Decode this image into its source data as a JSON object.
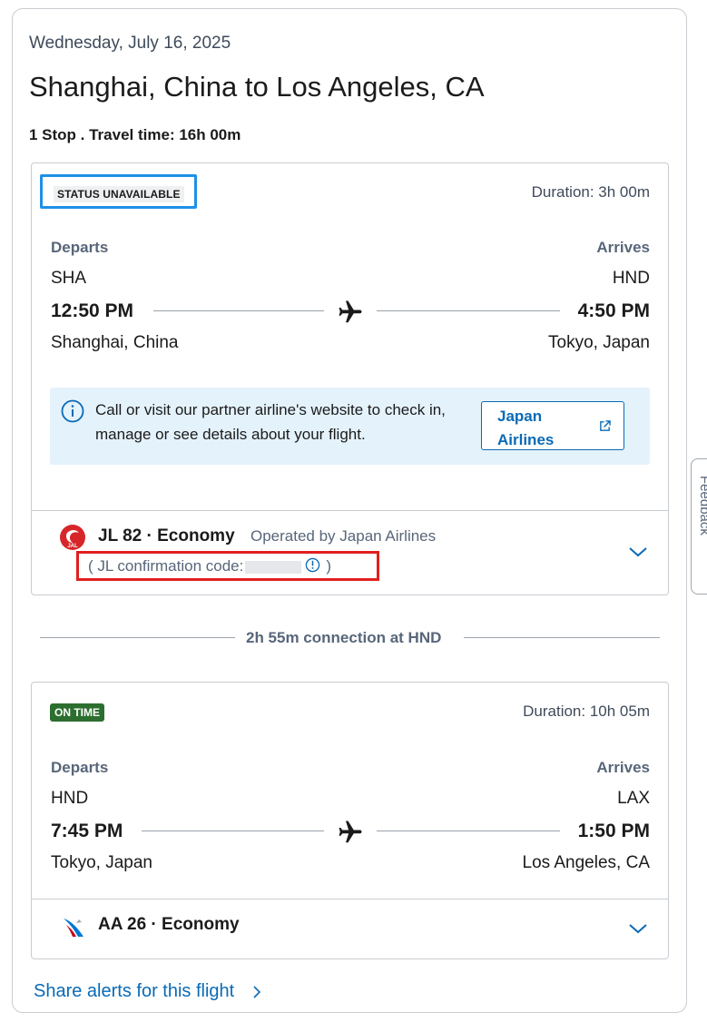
{
  "trip": {
    "date": "Wednesday, July 16, 2025",
    "route": "Shanghai, China to Los Angeles, CA",
    "summary": "1 Stop . Travel time: 16h 00m"
  },
  "segment1": {
    "status": "STATUS UNAVAILABLE",
    "duration": "Duration: 3h 00m",
    "departs_label": "Departs",
    "arrives_label": "Arrives",
    "from_code": "SHA",
    "to_code": "HND",
    "depart_time": "12:50 PM",
    "arrive_time": "4:50 PM",
    "from_city": "Shanghai, China",
    "to_city": "Tokyo, Japan",
    "info_text": "Call or visit our partner airline's website to check in, manage or see details about your flight.",
    "partner_button": "Japan Airlines",
    "flight": "JL 82 · Economy",
    "operated_by": "Operated by Japan Airlines",
    "confirmation_prefix": "( JL confirmation code:",
    "confirmation_suffix": ")"
  },
  "connection": {
    "text": "2h 55m connection at HND"
  },
  "segment2": {
    "status": "ON TIME",
    "duration": "Duration: 10h 05m",
    "departs_label": "Departs",
    "arrives_label": "Arrives",
    "from_code": "HND",
    "to_code": "LAX",
    "depart_time": "7:45 PM",
    "arrive_time": "1:50 PM",
    "from_city": "Tokyo, Japan",
    "to_city": "Los Angeles, CA",
    "flight": "AA 26 · Economy"
  },
  "share_alerts": "Share alerts for this flight",
  "feedback": "Feedback",
  "colors": {
    "link_blue": "#0a6ab6",
    "highlight_blue": "#1e90e8",
    "highlight_red": "#e11f1f",
    "on_time_green": "#2c6e2f",
    "info_bg": "#e4f2fc"
  },
  "icons": [
    "airplane-icon",
    "info-icon",
    "external-link-icon",
    "chevron-down-icon",
    "chevron-right-icon",
    "jal-logo",
    "aa-logo"
  ]
}
